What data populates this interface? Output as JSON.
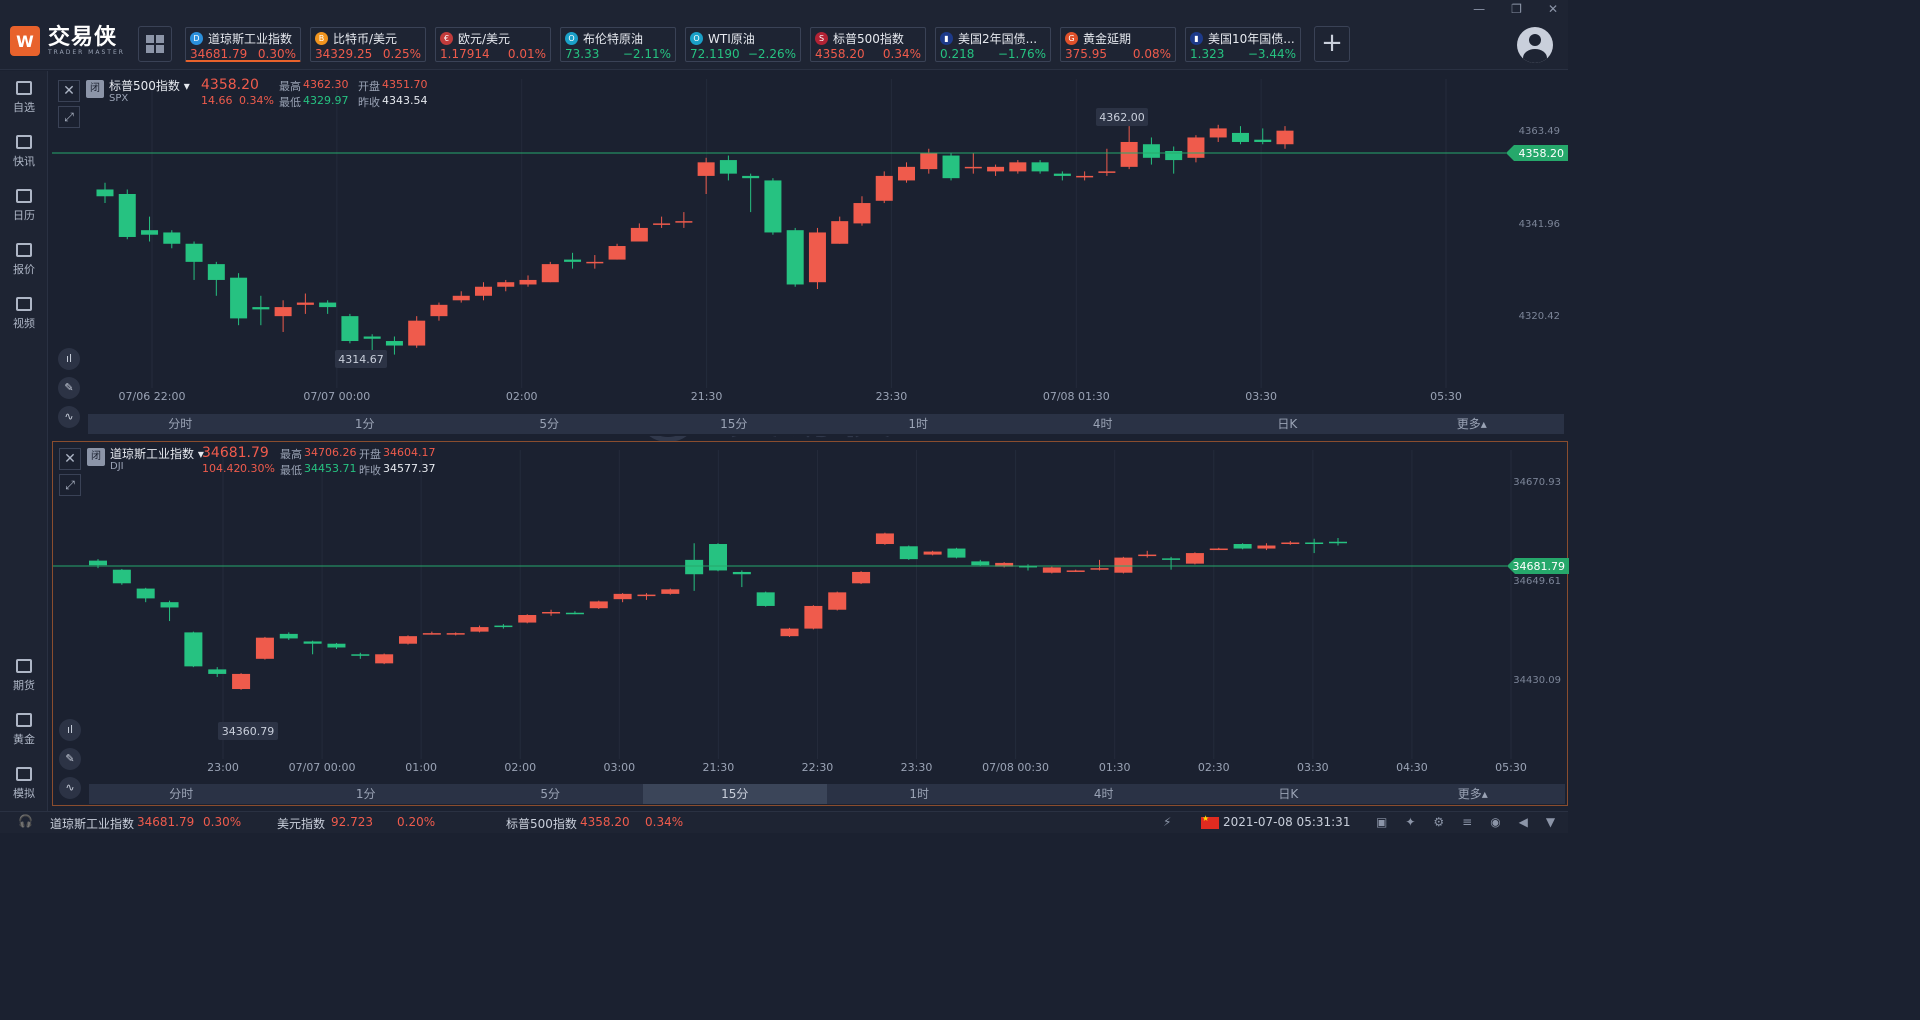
{
  "app": {
    "name_cn": "交易侠",
    "name_en": "TRADER MASTER",
    "logo_glyph": "W"
  },
  "tickers": [
    {
      "name": "道琼斯工业指数",
      "price": "34681.79",
      "change": "0.30%",
      "dir": "up",
      "icon": "dow-icon",
      "icon_color": "#2b8fdb",
      "icon_glyph": "D",
      "active": true
    },
    {
      "name": "比特币/美元",
      "price": "34329.25",
      "change": "0.25%",
      "dir": "up",
      "icon": "bitcoin-icon",
      "icon_color": "#f0941e",
      "icon_glyph": "B"
    },
    {
      "name": "欧元/美元",
      "price": "1.17914",
      "change": "0.01%",
      "dir": "up",
      "icon": "eu-flag-icon",
      "icon_color": "#c23b3b",
      "icon_glyph": "€"
    },
    {
      "name": "布伦特原油",
      "price": "73.33",
      "change": "−2.11%",
      "dir": "down",
      "icon": "oil-icon",
      "icon_color": "#1aa0c8",
      "icon_glyph": "O"
    },
    {
      "name": "WTI原油",
      "price": "72.1190",
      "change": "−2.26%",
      "dir": "down",
      "icon": "oil-icon",
      "icon_color": "#1aa0c8",
      "icon_glyph": "O"
    },
    {
      "name": "标普500指数",
      "price": "4358.20",
      "change": "0.34%",
      "dir": "up",
      "icon": "us-flag-icon",
      "icon_color": "#b22234",
      "icon_glyph": "S"
    },
    {
      "name": "美国2年国债...",
      "price": "0.218",
      "change": "−1.76%",
      "dir": "down",
      "icon": "bond-icon",
      "icon_color": "#1d3a8a",
      "icon_glyph": "▮"
    },
    {
      "name": "黄金延期",
      "price": "375.95",
      "change": "0.08%",
      "dir": "up",
      "icon": "gold-icon",
      "icon_color": "#e0502a",
      "icon_glyph": "G"
    },
    {
      "name": "美国10年国债...",
      "price": "1.323",
      "change": "−3.44%",
      "dir": "down",
      "icon": "bond-icon",
      "icon_color": "#1d3a8a",
      "icon_glyph": "▮"
    }
  ],
  "sidebar": {
    "top": [
      {
        "label": "自选",
        "icon": "watchlist-icon"
      },
      {
        "label": "快讯",
        "icon": "news-icon"
      },
      {
        "label": "日历",
        "icon": "calendar-icon"
      },
      {
        "label": "报价",
        "icon": "quote-icon"
      },
      {
        "label": "视频",
        "icon": "video-icon"
      }
    ],
    "bottom": [
      {
        "label": "期货",
        "icon": "futures-icon"
      },
      {
        "label": "黄金",
        "icon": "gold-icon"
      },
      {
        "label": "模拟",
        "icon": "simulate-icon"
      }
    ]
  },
  "panels": [
    {
      "name": "标普500指数",
      "code": "SPX",
      "badge": "闭",
      "price": "4358.20",
      "change": "14.66",
      "change_pct": "0.34%",
      "high_label": "最高",
      "high": "4362.30",
      "open_label": "开盘",
      "open": "4351.70",
      "low_label": "最低",
      "low": "4329.97",
      "prev_label": "昨收",
      "prev": "4343.54",
      "current_tag": "4358.20",
      "max_tag": "4362.00",
      "min_tag": "4314.67",
      "y_ticks": [
        "4363.49",
        "4341.96",
        "4320.42"
      ],
      "x_ticks": [
        "07/06 22:00",
        "07/07 00:00",
        "02:00",
        "21:30",
        "23:30",
        "07/08 01:30",
        "03:30",
        "05:30"
      ],
      "timeframes": [
        "分时",
        "1分",
        "5分",
        "15分",
        "1时",
        "4时",
        "日K",
        "更多▴"
      ],
      "selected_tf": -1
    },
    {
      "name": "道琼斯工业指数",
      "code": "DJI",
      "badge": "闭",
      "price": "34681.79",
      "change": "104.42",
      "change_pct": "0.30%",
      "high_label": "最高",
      "high": "34706.26",
      "open_label": "开盘",
      "open": "34604.17",
      "low_label": "最低",
      "low": "34453.71",
      "prev_label": "昨收",
      "prev": "34577.37",
      "current_tag": "34681.79",
      "max_tag": "",
      "min_tag": "34360.79",
      "y_ticks": [
        "34670.93",
        "34649.61",
        "34430.09"
      ],
      "x_ticks": [
        "23:00",
        "07/07 00:00",
        "01:00",
        "02:00",
        "03:00",
        "21:30",
        "22:30",
        "23:30",
        "07/08 00:30",
        "01:30",
        "02:30",
        "03:30",
        "04:30",
        "05:30"
      ],
      "timeframes": [
        "分时",
        "1分",
        "5分",
        "15分",
        "1时",
        "4时",
        "日K",
        "更多▴"
      ],
      "selected_tf": 3
    }
  ],
  "chart_data": [
    {
      "type": "candlestick",
      "title": "标普500指数",
      "ylim": [
        4305,
        4368
      ],
      "up_color": "#ef5b4c",
      "down_color": "#26c281",
      "candles": [
        [
          4348.0,
          4346.5,
          4349.5,
          4345.0
        ],
        [
          4347.0,
          4337.5,
          4348.0,
          4337.0
        ],
        [
          4339.0,
          4338.0,
          4342.0,
          4336.5
        ],
        [
          4338.5,
          4336.0,
          4339.0,
          4335.0
        ],
        [
          4336.0,
          4332.0,
          4336.5,
          4328.0
        ],
        [
          4331.5,
          4328.0,
          4332.0,
          4324.5
        ],
        [
          4328.5,
          4319.5,
          4329.5,
          4318.0
        ],
        [
          4322.0,
          4321.5,
          4324.5,
          4318.0
        ],
        [
          4320.0,
          4322.0,
          4323.5,
          4316.5
        ],
        [
          4322.5,
          4323.0,
          4325.0,
          4320.5
        ],
        [
          4323.0,
          4322.0,
          4323.5,
          4320.5
        ],
        [
          4320.0,
          4314.5,
          4320.5,
          4314.0
        ],
        [
          4315.5,
          4315.0,
          4316.0,
          4311.5
        ],
        [
          4314.5,
          4313.5,
          4315.5,
          4311.5
        ],
        [
          4313.5,
          4319.0,
          4320.0,
          4313.0
        ],
        [
          4320.0,
          4322.5,
          4323.0,
          4319.0
        ],
        [
          4323.5,
          4324.5,
          4325.5,
          4323.0
        ],
        [
          4324.5,
          4326.5,
          4327.5,
          4323.5
        ],
        [
          4326.5,
          4327.5,
          4328.0,
          4325.5
        ],
        [
          4327.0,
          4328.0,
          4329.0,
          4326.5
        ],
        [
          4327.5,
          4331.5,
          4332.0,
          4327.5
        ],
        [
          4332.5,
          4332.0,
          4334.0,
          4330.5
        ],
        [
          4332.0,
          4332.0,
          4333.5,
          4330.5
        ],
        [
          4332.5,
          4335.5,
          4336.0,
          4332.5
        ],
        [
          4336.5,
          4339.5,
          4340.5,
          4336.5
        ],
        [
          4340.5,
          4340.5,
          4342.0,
          4339.5
        ],
        [
          4341.0,
          4341.0,
          4343.0,
          4339.5
        ],
        [
          4351.0,
          4354.0,
          4355.0,
          4347.0
        ],
        [
          4354.5,
          4351.5,
          4355.5,
          4350.0
        ],
        [
          4351.0,
          4350.5,
          4351.5,
          4343.0
        ],
        [
          4350.0,
          4338.5,
          4350.5,
          4338.0
        ],
        [
          4339.0,
          4327.0,
          4339.5,
          4326.5
        ],
        [
          4327.5,
          4338.5,
          4339.5,
          4326.0
        ],
        [
          4336.0,
          4341.0,
          4342.0,
          4336.0
        ],
        [
          4340.5,
          4345.0,
          4346.5,
          4340.0
        ],
        [
          4345.5,
          4351.0,
          4352.0,
          4345.0
        ],
        [
          4350.0,
          4353.0,
          4354.0,
          4349.5
        ],
        [
          4352.5,
          4356.0,
          4357.0,
          4351.5
        ],
        [
          4355.5,
          4350.5,
          4356.0,
          4350.0
        ],
        [
          4353.0,
          4353.0,
          4356.0,
          4351.5
        ],
        [
          4352.0,
          4353.0,
          4353.5,
          4351.0
        ],
        [
          4352.0,
          4354.0,
          4354.5,
          4351.5
        ],
        [
          4354.0,
          4352.0,
          4354.5,
          4351.5
        ],
        [
          4351.5,
          4351.0,
          4352.0,
          4350.0
        ],
        [
          4351.0,
          4351.0,
          4352.0,
          4350.0
        ],
        [
          4352.0,
          4352.0,
          4357.0,
          4351.0
        ],
        [
          4353.0,
          4358.5,
          4362.0,
          4352.5
        ],
        [
          4358.0,
          4355.0,
          4359.5,
          4353.5
        ],
        [
          4356.5,
          4354.5,
          4357.5,
          4351.5
        ],
        [
          4355.0,
          4359.5,
          4360.0,
          4354.0
        ],
        [
          4359.5,
          4361.5,
          4362.3,
          4358.5
        ],
        [
          4360.5,
          4358.5,
          4362.0,
          4358.0
        ],
        [
          4359.0,
          4358.5,
          4361.5,
          4358.0
        ],
        [
          4358.0,
          4361.0,
          4362.0,
          4357.0
        ]
      ]
    },
    {
      "type": "candlestick",
      "title": "道琼斯工业指数",
      "ylim": [
        34330,
        34710
      ],
      "up_color": "#ef5b4c",
      "down_color": "#26c281",
      "candles": [
        [
          34590.0,
          34584.0,
          34592.0,
          34580.0
        ],
        [
          34578.0,
          34560.0,
          34579.0,
          34558.0
        ],
        [
          34553.0,
          34540.0,
          34554.0,
          34535.0
        ],
        [
          34535.0,
          34528.0,
          34537.0,
          34510.0
        ],
        [
          34495.0,
          34450.0,
          34496.0,
          34449.0
        ],
        [
          34446.0,
          34440.0,
          34449.0,
          34436.0
        ],
        [
          34420.0,
          34440.0,
          34441.0,
          34419.0
        ],
        [
          34460.0,
          34488.0,
          34489.0,
          34459.0
        ],
        [
          34493.0,
          34487.0,
          34495.0,
          34485.0
        ],
        [
          34483.0,
          34480.0,
          34484.0,
          34466.0
        ],
        [
          34480.0,
          34475.0,
          34481.0,
          34473.0
        ],
        [
          34466.0,
          34464.0,
          34468.0,
          34460.0
        ],
        [
          34454.0,
          34466.0,
          34467.0,
          34453.0
        ],
        [
          34480.0,
          34490.0,
          34491.0,
          34479.0
        ],
        [
          34494.0,
          34494.0,
          34496.0,
          34492.0
        ],
        [
          34493.0,
          34494.0,
          34495.0,
          34491.0
        ],
        [
          34496.0,
          34502.0,
          34504.0,
          34495.0
        ],
        [
          34504.0,
          34502.0,
          34506.0,
          34500.0
        ],
        [
          34508.0,
          34518.0,
          34519.0,
          34507.0
        ],
        [
          34522.0,
          34522.0,
          34525.0,
          34517.0
        ],
        [
          34521.0,
          34520.0,
          34523.0,
          34519.0
        ],
        [
          34527.0,
          34536.0,
          34537.0,
          34526.0
        ],
        [
          34539.0,
          34546.0,
          34547.0,
          34535.0
        ],
        [
          34545.0,
          34545.0,
          34547.0,
          34538.0
        ],
        [
          34546.0,
          34552.0,
          34553.0,
          34545.0
        ],
        [
          34591.0,
          34572.0,
          34613.0,
          34550.0
        ],
        [
          34612.0,
          34577.0,
          34613.0,
          34576.0
        ],
        [
          34575.0,
          34572.0,
          34577.0,
          34555.0
        ],
        [
          34548.0,
          34530.0,
          34549.0,
          34529.0
        ],
        [
          34490.0,
          34500.0,
          34501.0,
          34489.0
        ],
        [
          34500.0,
          34530.0,
          34531.0,
          34499.0
        ],
        [
          34525.0,
          34548.0,
          34549.0,
          34524.0
        ],
        [
          34560.0,
          34575.0,
          34576.0,
          34559.0
        ],
        [
          34612.0,
          34626.0,
          34627.0,
          34611.0
        ],
        [
          34609.0,
          34592.0,
          34610.0,
          34591.0
        ],
        [
          34598.0,
          34602.0,
          34603.0,
          34597.0
        ],
        [
          34606.0,
          34594.0,
          34607.0,
          34593.0
        ],
        [
          34589.0,
          34584.0,
          34591.0,
          34583.0
        ],
        [
          34582.0,
          34587.0,
          34588.0,
          34581.0
        ],
        [
          34583.0,
          34581.0,
          34585.0,
          34577.0
        ],
        [
          34574.0,
          34581.0,
          34582.0,
          34573.0
        ],
        [
          34577.0,
          34577.0,
          34578.0,
          34575.0
        ],
        [
          34578.0,
          34580.0,
          34591.0,
          34577.0
        ],
        [
          34574.0,
          34594.0,
          34595.0,
          34573.0
        ],
        [
          34598.0,
          34598.0,
          34603.0,
          34594.0
        ],
        [
          34593.0,
          34591.0,
          34595.0,
          34578.0
        ],
        [
          34586.0,
          34600.0,
          34601.0,
          34585.0
        ],
        [
          34605.0,
          34606.0,
          34607.0,
          34604.0
        ],
        [
          34612.0,
          34606.0,
          34613.0,
          34605.0
        ],
        [
          34606.0,
          34610.0,
          34613.0,
          34604.0
        ],
        [
          34612.0,
          34614.0,
          34616.0,
          34611.0
        ],
        [
          34614.0,
          34613.0,
          34619.0,
          34600.0
        ],
        [
          34615.0,
          34614.0,
          34620.0,
          34610.0
        ]
      ]
    }
  ],
  "bottom": {
    "items": [
      {
        "name": "道琼斯工业指数",
        "price": "34681.79",
        "change": "0.30%"
      },
      {
        "name": "美元指数",
        "price": "92.723",
        "change": "0.20%"
      },
      {
        "name": "标普500指数",
        "price": "4358.20",
        "change": "0.34%"
      }
    ],
    "datetime": "2021-07-08 05:31:31"
  },
  "colors": {
    "accent": "#e8622c",
    "up": "#ef5b4c",
    "down": "#26c281",
    "current_tag": "#26a86b"
  }
}
